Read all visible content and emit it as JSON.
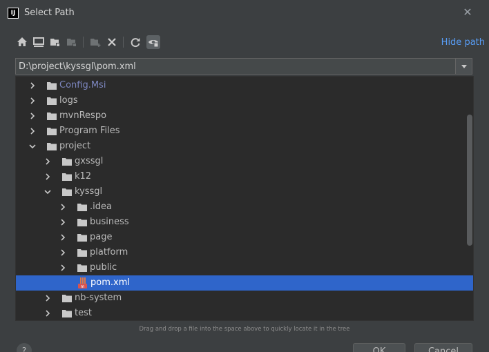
{
  "window": {
    "title": "Select Path",
    "app_icon": "intellij-icon",
    "close_glyph": "✕"
  },
  "toolbar": {
    "icons": [
      "home-icon",
      "desktop-icon",
      "project-icon",
      "module-icon",
      "new-folder-icon",
      "delete-icon",
      "refresh-icon",
      "show-hidden-icon"
    ],
    "hide_path_label": "Hide path"
  },
  "path": {
    "value": "D:\\project\\kyssgl\\pom.xml"
  },
  "tree": {
    "items": [
      {
        "label": "Config.Msi",
        "depth": 0,
        "expanded": false,
        "type": "folder",
        "muted": true
      },
      {
        "label": "logs",
        "depth": 0,
        "expanded": false,
        "type": "folder"
      },
      {
        "label": "mvnRespo",
        "depth": 0,
        "expanded": false,
        "type": "folder"
      },
      {
        "label": "Program Files",
        "depth": 0,
        "expanded": false,
        "type": "folder"
      },
      {
        "label": "project",
        "depth": 0,
        "expanded": true,
        "type": "folder"
      },
      {
        "label": "gxssgl",
        "depth": 1,
        "expanded": false,
        "type": "folder"
      },
      {
        "label": "k12",
        "depth": 1,
        "expanded": false,
        "type": "folder"
      },
      {
        "label": "kyssgl",
        "depth": 1,
        "expanded": true,
        "type": "folder"
      },
      {
        "label": ".idea",
        "depth": 2,
        "expanded": false,
        "type": "folder"
      },
      {
        "label": "business",
        "depth": 2,
        "expanded": false,
        "type": "folder"
      },
      {
        "label": "page",
        "depth": 2,
        "expanded": false,
        "type": "folder"
      },
      {
        "label": "platform",
        "depth": 2,
        "expanded": false,
        "type": "folder"
      },
      {
        "label": "public",
        "depth": 2,
        "expanded": false,
        "type": "folder"
      },
      {
        "label": "pom.xml",
        "depth": 2,
        "type": "maven-file",
        "selected": true
      },
      {
        "label": "nb-system",
        "depth": 1,
        "expanded": false,
        "type": "folder"
      },
      {
        "label": "test",
        "depth": 1,
        "expanded": false,
        "type": "folder"
      }
    ]
  },
  "hint": "Drag and drop a file into the space above to quickly locate it in the tree",
  "buttons": {
    "help_label": "?",
    "ok_label": "OK",
    "cancel_label": "Cancel"
  },
  "colors": {
    "background": "#3c3f41",
    "tree_background": "#2b2b2b",
    "selection": "#2f65ca",
    "link": "#589df6",
    "muted_folder": "#7c86bf"
  }
}
